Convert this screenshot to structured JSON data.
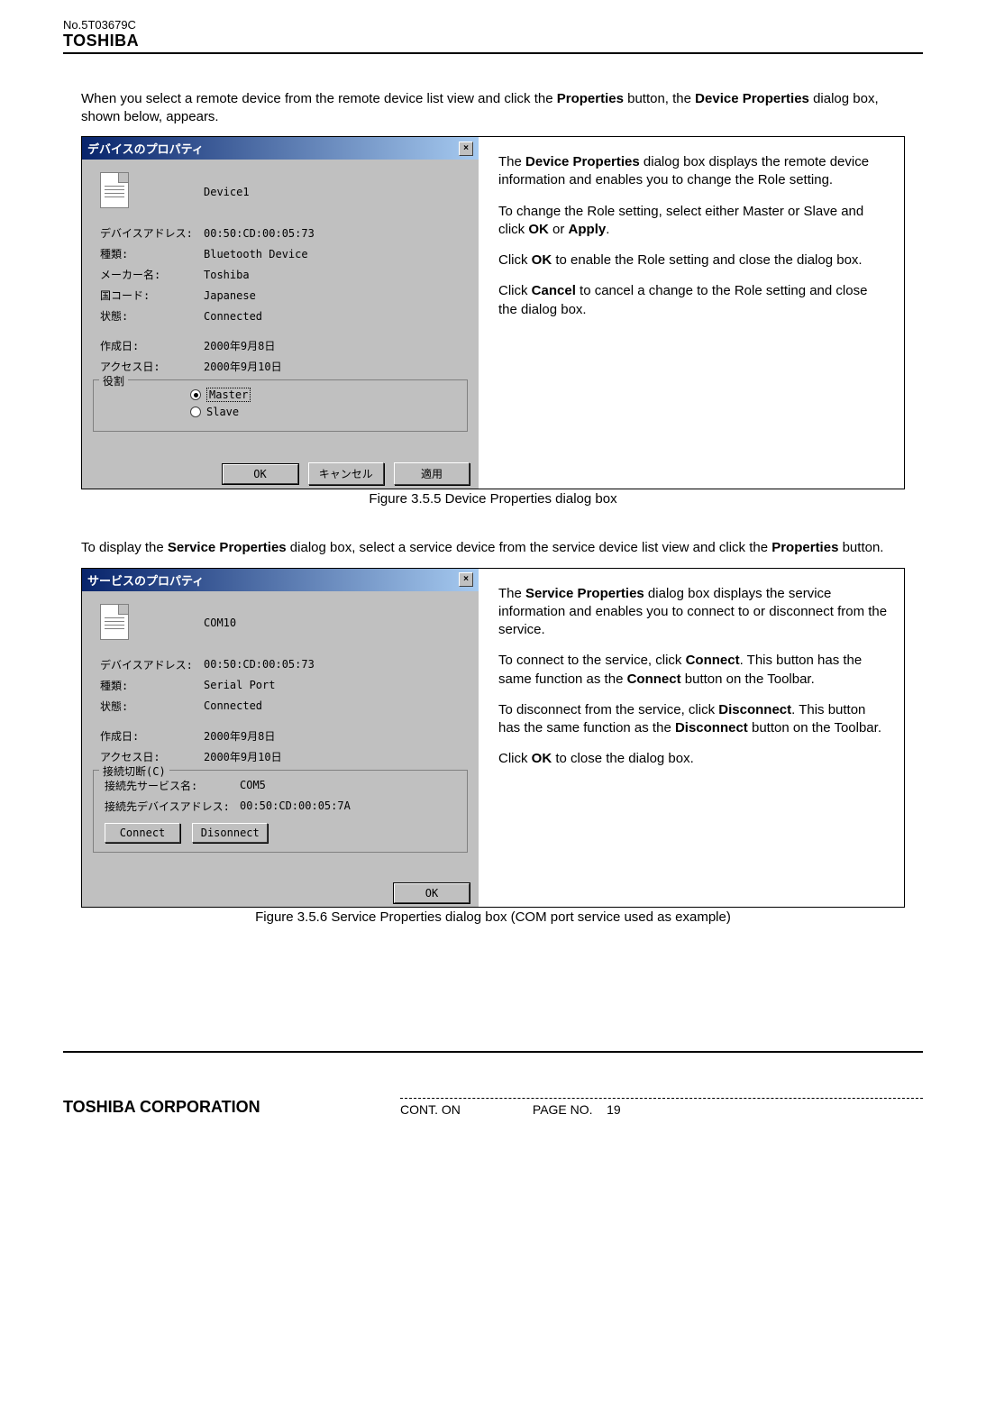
{
  "header": {
    "doc_no": "No.5T03679C",
    "company": "TOSHIBA"
  },
  "intro1_a": "When you select a remote device from the remote device list view and click the ",
  "intro1_b": "Properties",
  "intro1_c": " button, the ",
  "intro1_d": "Device Properties",
  "intro1_e": " dialog box, shown below, appears.",
  "dialog1": {
    "title": "デバイスのプロパティ",
    "device_name": "Device1",
    "addr_label": "デバイスアドレス:",
    "addr_value": "00:50:CD:00:05:73",
    "type_label": "種類:",
    "type_value": "Bluetooth Device",
    "maker_label": "メーカー名:",
    "maker_value": "Toshiba",
    "country_label": "国コード:",
    "country_value": "Japanese",
    "status_label": "状態:",
    "status_value": "Connected",
    "created_label": "作成日:",
    "created_value": "2000年9月8日",
    "access_label": "アクセス日:",
    "access_value": "2000年9月10日",
    "role_legend": "役割",
    "role_master": "Master",
    "role_slave": "Slave",
    "ok_btn": "OK",
    "cancel_btn": "キャンセル",
    "apply_btn": "適用"
  },
  "explain1": {
    "p1_a": "The ",
    "p1_b": "Device Properties",
    "p1_c": " dialog box displays the remote device information and enables you to change the Role setting.",
    "p2_a": "To change the Role setting, select either Master or Slave and click ",
    "p2_b": "OK",
    "p2_c": " or ",
    "p2_d": "Apply",
    "p2_e": ".",
    "p3_a": "Click ",
    "p3_b": "OK",
    "p3_c": " to enable the Role setting and close the dialog box.",
    "p4_a": "Click ",
    "p4_b": "Cancel",
    "p4_c": " to cancel a change to the Role setting and close the dialog box."
  },
  "figcap1": "Figure 3.5.5 Device Properties dialog box",
  "intro2_a": "To display the ",
  "intro2_b": "Service Properties",
  "intro2_c": " dialog box, select a service device from the service device list view and click the ",
  "intro2_d": "Properties",
  "intro2_e": " button.",
  "dialog2": {
    "title": "サービスのプロパティ",
    "service_name": "COM10",
    "addr_label": "デバイスアドレス:",
    "addr_value": "00:50:CD:00:05:73",
    "type_label": "種類:",
    "type_value": "Serial Port",
    "status_label": "状態:",
    "status_value": "Connected",
    "created_label": "作成日:",
    "created_value": "2000年9月8日",
    "access_label": "アクセス日:",
    "access_value": "2000年9月10日",
    "disc_legend": "接続切断(C)",
    "conn_service_label": "接続先サービス名:",
    "conn_service_value": "COM5",
    "conn_addr_label": "接続先デバイスアドレス:",
    "conn_addr_value": "00:50:CD:00:05:7A",
    "connect_btn": "Connect",
    "disconnect_btn": "Disonnect",
    "ok_btn": "OK"
  },
  "explain2": {
    "p1_a": "The ",
    "p1_b": "Service Properties",
    "p1_c": " dialog box displays the service information and enables you to connect to or disconnect from the service.",
    "p2_a": "To connect to the service, click ",
    "p2_b": "Connect",
    "p2_c": ". This button has the same function as the ",
    "p2_d": "Connect",
    "p2_e": " button on the Toolbar.",
    "p3_a": "To disconnect from the service, click ",
    "p3_b": "Disconnect",
    "p3_c": ". This button has the same function as the ",
    "p3_d": "Disconnect",
    "p3_e": " button on the Toolbar.",
    "p4_a": "Click ",
    "p4_b": "OK",
    "p4_c": " to close the dialog box."
  },
  "figcap2": "Figure 3.5.6 Service Properties dialog box (COM port service used as example)",
  "footer": {
    "company": "TOSHIBA CORPORATION",
    "cont_on": "CONT. ON",
    "page_label": "PAGE NO.",
    "page_value": "19"
  }
}
